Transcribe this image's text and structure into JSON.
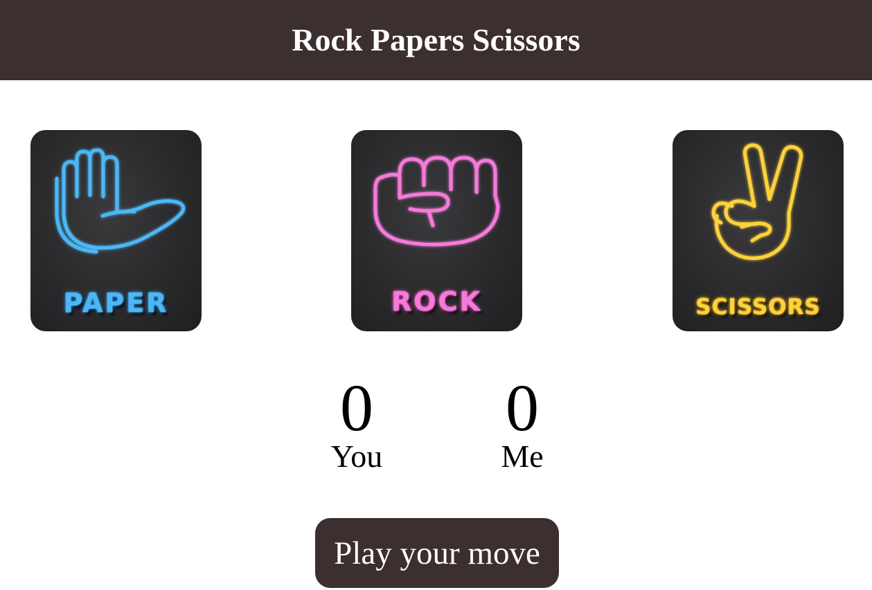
{
  "header": {
    "title": "Rock Papers Scissors"
  },
  "choices": [
    {
      "id": "paper",
      "label": "PAPER",
      "icon": "open-hand-icon",
      "color": "#4db7f5"
    },
    {
      "id": "rock",
      "label": "ROCK",
      "icon": "fist-icon",
      "color": "#f57ad9"
    },
    {
      "id": "scissors",
      "label": "SCISSORS",
      "icon": "peace-hand-icon",
      "color": "#ffd23a"
    }
  ],
  "scores": {
    "user": {
      "value": "0",
      "label": "You"
    },
    "computer": {
      "value": "0",
      "label": "Me"
    }
  },
  "message": {
    "text": "Play your move"
  },
  "colors": {
    "header_bg": "#3b2f2f",
    "button_bg": "#3b2f2f"
  }
}
